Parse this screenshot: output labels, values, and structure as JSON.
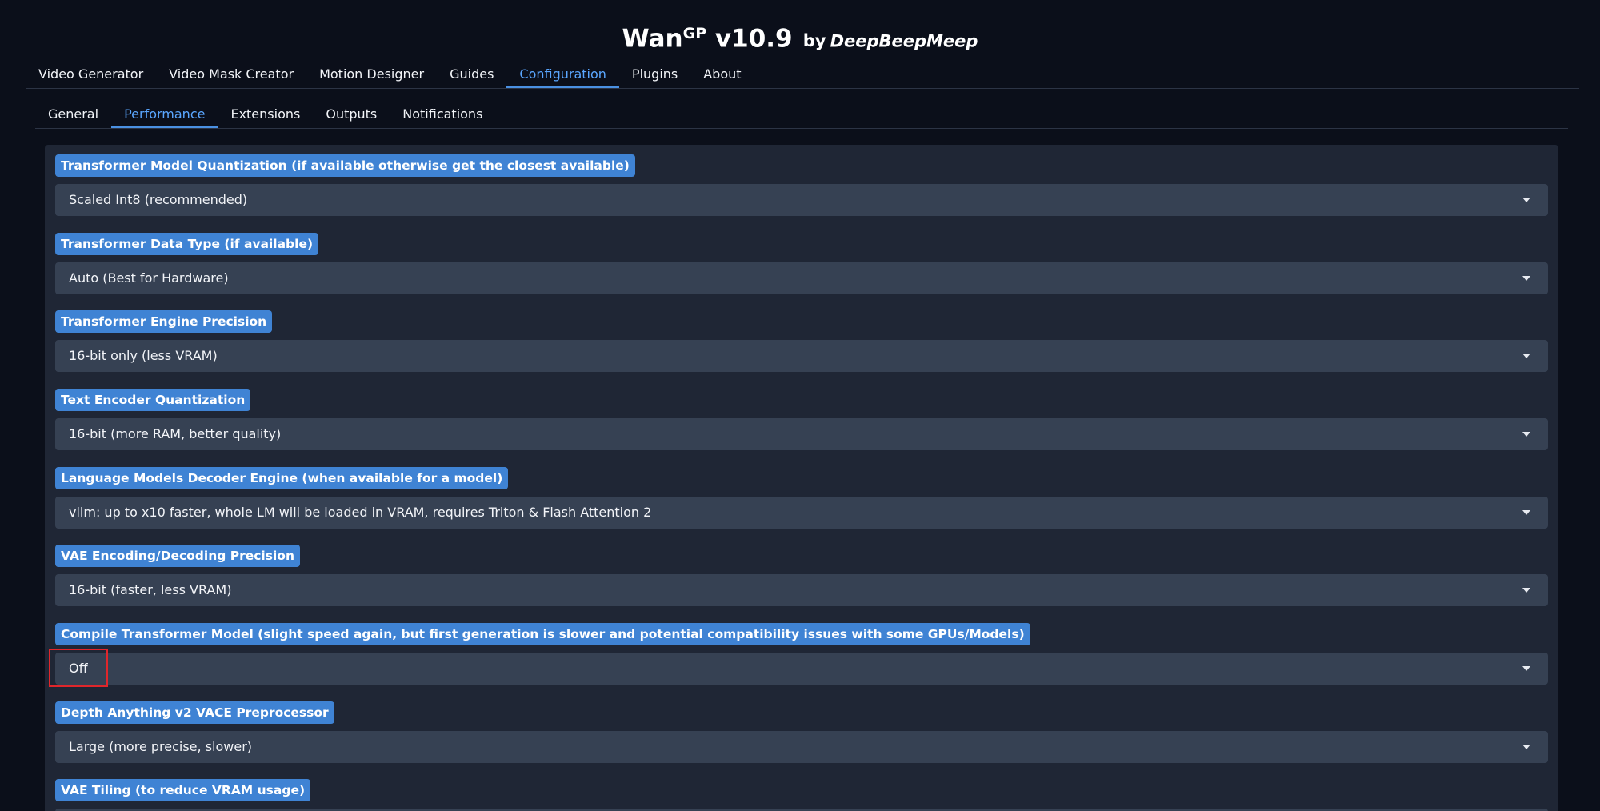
{
  "header": {
    "title_main": "Wan",
    "title_sup": "GP",
    "title_version": " v10.9",
    "title_by": "by",
    "title_author": "DeepBeepMeep"
  },
  "top_tabs": [
    {
      "label": "Video Generator",
      "active": false
    },
    {
      "label": "Video Mask Creator",
      "active": false
    },
    {
      "label": "Motion Designer",
      "active": false
    },
    {
      "label": "Guides",
      "active": false
    },
    {
      "label": "Configuration",
      "active": true
    },
    {
      "label": "Plugins",
      "active": false
    },
    {
      "label": "About",
      "active": false
    }
  ],
  "sub_tabs": [
    {
      "label": "General",
      "active": false
    },
    {
      "label": "Performance",
      "active": true
    },
    {
      "label": "Extensions",
      "active": false
    },
    {
      "label": "Outputs",
      "active": false
    },
    {
      "label": "Notifications",
      "active": false
    }
  ],
  "fields": [
    {
      "label": "Transformer Model Quantization (if available otherwise get the closest available)",
      "value": "Scaled Int8 (recommended)"
    },
    {
      "label": "Transformer Data Type (if available)",
      "value": "Auto (Best for Hardware)"
    },
    {
      "label": "Transformer Engine Precision",
      "value": "16-bit only (less VRAM)"
    },
    {
      "label": "Text Encoder Quantization",
      "value": "16-bit (more RAM, better quality)"
    },
    {
      "label": "Language Models Decoder Engine (when available for a model)",
      "value": "vllm: up to x10 faster, whole LM will be loaded in VRAM, requires Triton & Flash Attention 2"
    },
    {
      "label": "VAE Encoding/Decoding Precision",
      "value": "16-bit (faster, less VRAM)"
    },
    {
      "label": "Compile Transformer Model (slight speed again, but first generation is slower and potential compatibility issues with some GPUs/Models)",
      "value": "Off",
      "highlighted": true
    },
    {
      "label": "Depth Anything v2 VACE Preprocessor",
      "value": "Large (more precise, slower)"
    },
    {
      "label": "VAE Tiling (to reduce VRAM usage)",
      "value": ""
    }
  ],
  "colors": {
    "background": "#0b0f1a",
    "panel": "#1f2635",
    "label_bg": "#3f83d4",
    "select_bg": "#364153",
    "active_tab": "#5aa6ff",
    "highlight_box": "#e0262b"
  }
}
